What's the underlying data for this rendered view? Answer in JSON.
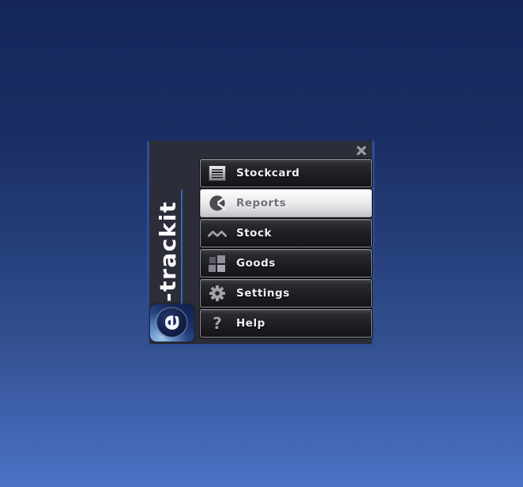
{
  "window": {
    "controls": {
      "close_icon": "x-icon"
    }
  },
  "brand": {
    "name": "e-trackit",
    "vertical_text": "-trackit",
    "logo_letter": "e"
  },
  "menu": {
    "items": [
      {
        "label": "Stockcard",
        "icon": "stockcard-document-icon",
        "selected": false
      },
      {
        "label": "Reports",
        "icon": "reports-pie-chart-icon",
        "selected": true
      },
      {
        "label": "Stock",
        "icon": "stock-zigzag-chart-icon",
        "selected": false
      },
      {
        "label": "Goods",
        "icon": "goods-blocks-icon",
        "selected": false
      },
      {
        "label": "Settings",
        "icon": "settings-gear-icon",
        "selected": false
      },
      {
        "label": "Help",
        "icon": "help-question-icon",
        "glyph": "?",
        "selected": false
      }
    ]
  },
  "colors": {
    "background_top": "#14265a",
    "background_bottom": "#4b72c4",
    "panel_bg": "#2b2d38",
    "panel_accent_border": "#2d4e96",
    "button_bg_dark": "#1e1e24",
    "selected_button_bg": "#e9e9ec",
    "selected_button_text": "#70707a",
    "button_text": "#f0f0f2",
    "icon_gray": "#a2a2a8",
    "underline_blue": "#3c63ad"
  }
}
